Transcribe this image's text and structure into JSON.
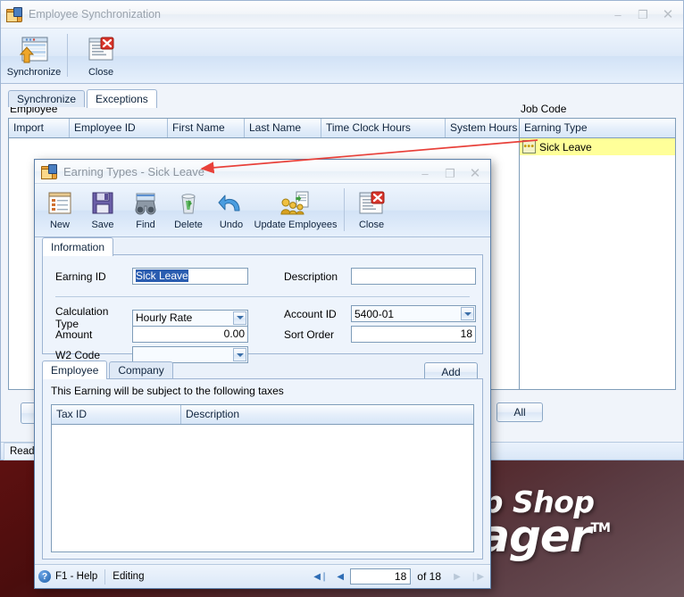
{
  "desktop": {
    "logo_line1": "mp Shop",
    "logo_line2": "anager",
    "logo_tm": "TM"
  },
  "main_window": {
    "title": "Employee Synchronization",
    "app_icon": "folder-app-icon",
    "window_controls": {
      "minimize": "–",
      "maximize": "❐",
      "close": "✕"
    },
    "toolbar": [
      {
        "label": "Synchronize",
        "icon": "synchronize-grid-icon"
      },
      {
        "label": "Close",
        "icon": "close-window-icon"
      }
    ],
    "tabs": [
      {
        "label": "Synchronize",
        "active": false
      },
      {
        "label": "Exceptions",
        "active": true
      }
    ],
    "employee_panel": {
      "label": "Employee",
      "columns": [
        "Import",
        "Employee ID",
        "First Name",
        "Last Name",
        "Time Clock Hours",
        "System Hours"
      ],
      "rows": []
    },
    "job_code_panel": {
      "label": "Job Code",
      "columns": [
        "Earning Type"
      ],
      "rows": [
        {
          "text": "Sick Leave",
          "highlighted": true,
          "button_icon": "ellipsis-icon"
        }
      ]
    },
    "all_button": "All",
    "status": {
      "text": "Ready"
    }
  },
  "dialog": {
    "title": "Earning Types - Sick Leave",
    "app_icon": "folder-app-icon",
    "window_controls": {
      "minimize": "–",
      "maximize": "❐",
      "close": "✕"
    },
    "toolbar": [
      {
        "label": "New",
        "icon": "new-document-icon"
      },
      {
        "label": "Save",
        "icon": "floppy-disk-icon"
      },
      {
        "label": "Find",
        "icon": "binoculars-icon"
      },
      {
        "label": "Delete",
        "icon": "recycle-bin-icon"
      },
      {
        "label": "Undo",
        "icon": "undo-arrow-icon"
      },
      {
        "label": "Update Employees",
        "icon": "update-employees-icon"
      },
      {
        "label": "Close",
        "icon": "close-window-icon"
      }
    ],
    "tabs": [
      {
        "label": "Information",
        "active": true
      }
    ],
    "form": {
      "earning_id_label": "Earning ID",
      "earning_id_value": "Sick Leave",
      "description_label": "Description",
      "description_value": "",
      "calculation_type_label": "Calculation Type",
      "calculation_type_value": "Hourly Rate",
      "amount_label": "Amount",
      "amount_value": "0.00",
      "w2_code_label": "W2 Code",
      "w2_code_value": "",
      "account_id_label": "Account ID",
      "account_id_value": "5400-01",
      "sort_order_label": "Sort Order",
      "sort_order_value": "18"
    },
    "tax_section": {
      "tabs": [
        {
          "label": "Employee",
          "active": true
        },
        {
          "label": "Company",
          "active": false
        }
      ],
      "add_button": "Add",
      "note": "This Earning will be subject to the following taxes",
      "columns": [
        "Tax ID",
        "Description"
      ],
      "rows": []
    },
    "status": {
      "help": "F1 - Help",
      "mode": "Editing",
      "nav_first": "◀❘",
      "nav_prev": "◀",
      "record": "18",
      "of": "of",
      "total": "18",
      "nav_next": "▶",
      "nav_last": "❘▶"
    }
  },
  "annotation": {
    "color": "#e8413a",
    "type": "arrow"
  }
}
